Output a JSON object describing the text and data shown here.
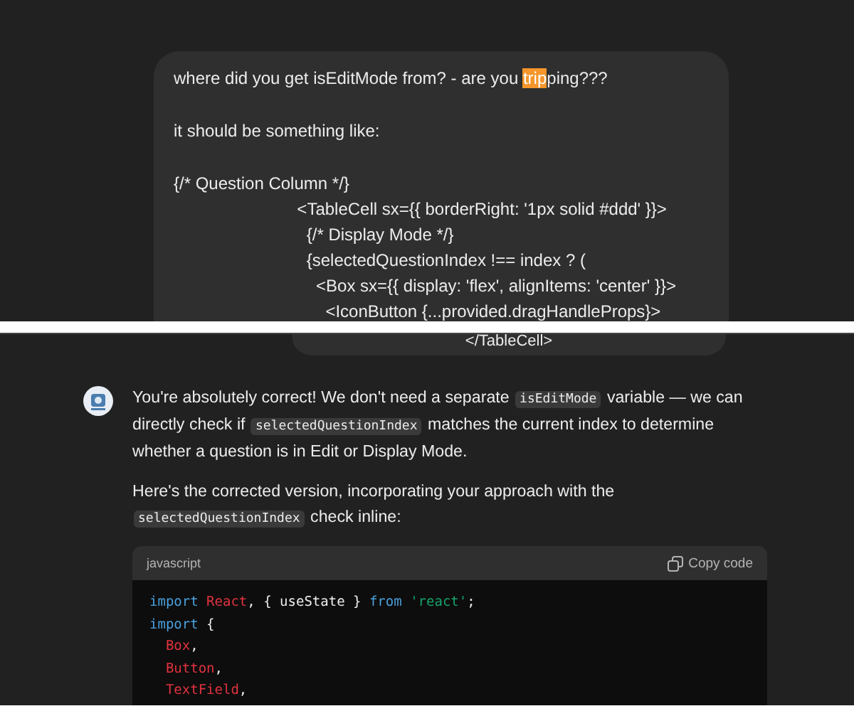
{
  "user_message": {
    "first_line": [
      {
        "text": "where did you get isEditMode from? - are you ",
        "highlighted": false
      },
      {
        "text": "trip",
        "highlighted": true
      },
      {
        "text": "ping???",
        "highlighted": false
      }
    ],
    "lines": [
      "it should be something like:",
      "{/* Question Column */}",
      "                          <TableCell sx={{ borderRight: '1px solid #ddd' }}>",
      "                            {/* Display Mode */}",
      "                            {selectedQuestionIndex !== index ? (",
      "                              <Box sx={{ display: 'flex', alignItems: 'center' }}>",
      "                                <IconButton {...provided.dragHandleProps}>"
    ],
    "continuation": "</TableCell>"
  },
  "assistant_message": {
    "paragraphs": [
      [
        {
          "text": "You're absolutely correct! We don't need a separate ",
          "code": false
        },
        {
          "text": "isEditMode",
          "code": true
        },
        {
          "text": " variable — we can directly check if ",
          "code": false
        },
        {
          "text": "selectedQuestionIndex",
          "code": true
        },
        {
          "text": " matches the current index to determine whether a question is in Edit or Display Mode.",
          "code": false
        }
      ],
      [
        {
          "text": "Here's the corrected version, incorporating your approach with the ",
          "code": false
        },
        {
          "text": "selectedQuestionIndex",
          "code": true
        },
        {
          "text": " check inline:",
          "code": false
        }
      ]
    ],
    "code_block": {
      "language": "javascript",
      "copy_label": "Copy code",
      "lines": [
        [
          {
            "text": "import",
            "kind": "keyword"
          },
          {
            "text": " React",
            "kind": "ident"
          },
          {
            "text": ", { useState } ",
            "kind": "plain"
          },
          {
            "text": "from",
            "kind": "keyword"
          },
          {
            "text": " 'react'",
            "kind": "string"
          },
          {
            "text": ";",
            "kind": "plain"
          }
        ],
        [
          {
            "text": "import",
            "kind": "keyword"
          },
          {
            "text": " {",
            "kind": "plain"
          }
        ],
        [
          {
            "text": "  Box",
            "kind": "ident"
          },
          {
            "text": ",",
            "kind": "plain"
          }
        ],
        [
          {
            "text": "  Button",
            "kind": "ident"
          },
          {
            "text": ",",
            "kind": "plain"
          }
        ],
        [
          {
            "text": "  TextField",
            "kind": "ident"
          },
          {
            "text": ",",
            "kind": "plain"
          }
        ]
      ]
    }
  }
}
